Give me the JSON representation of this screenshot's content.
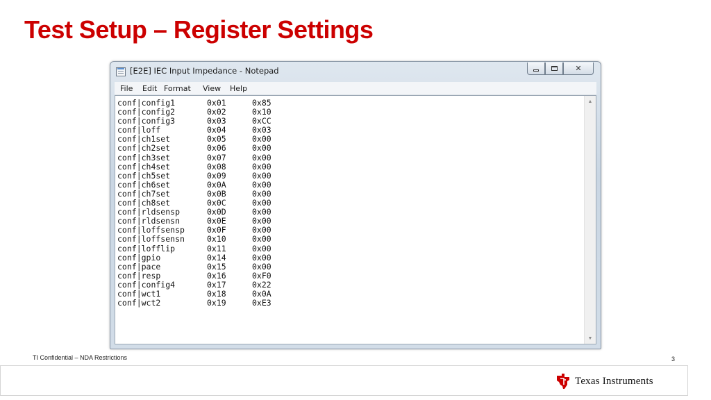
{
  "slide": {
    "title": "Test Setup – Register Settings",
    "footer": "TI Confidential – NDA Restrictions",
    "page_number": "3",
    "logo_text": "Texas Instruments"
  },
  "window": {
    "title": "[E2E] IEC Input Impedance - Notepad",
    "menu": [
      "File",
      "Edit",
      "Format",
      "View",
      "Help"
    ]
  },
  "registers": [
    {
      "name": "conf|config1",
      "addr": "0x01",
      "value": "0x85"
    },
    {
      "name": "conf|config2",
      "addr": "0x02",
      "value": "0x10"
    },
    {
      "name": "conf|config3",
      "addr": "0x03",
      "value": "0xCC"
    },
    {
      "name": "conf|loff",
      "addr": "0x04",
      "value": "0x03"
    },
    {
      "name": "conf|ch1set",
      "addr": "0x05",
      "value": "0x00"
    },
    {
      "name": "conf|ch2set",
      "addr": "0x06",
      "value": "0x00"
    },
    {
      "name": "conf|ch3set",
      "addr": "0x07",
      "value": "0x00"
    },
    {
      "name": "conf|ch4set",
      "addr": "0x08",
      "value": "0x00"
    },
    {
      "name": "conf|ch5set",
      "addr": "0x09",
      "value": "0x00"
    },
    {
      "name": "conf|ch6set",
      "addr": "0x0A",
      "value": "0x00"
    },
    {
      "name": "conf|ch7set",
      "addr": "0x0B",
      "value": "0x00"
    },
    {
      "name": "conf|ch8set",
      "addr": "0x0C",
      "value": "0x00"
    },
    {
      "name": "conf|rldsensp",
      "addr": "0x0D",
      "value": "0x00"
    },
    {
      "name": "conf|rldsensn",
      "addr": "0x0E",
      "value": "0x00"
    },
    {
      "name": "conf|loffsensp",
      "addr": "0x0F",
      "value": "0x00"
    },
    {
      "name": "conf|loffsensn",
      "addr": "0x10",
      "value": "0x00"
    },
    {
      "name": "conf|lofflip",
      "addr": "0x11",
      "value": "0x00"
    },
    {
      "name": "conf|gpio",
      "addr": "0x14",
      "value": "0x00"
    },
    {
      "name": "conf|pace",
      "addr": "0x15",
      "value": "0x00"
    },
    {
      "name": "conf|resp",
      "addr": "0x16",
      "value": "0xF0"
    },
    {
      "name": "conf|config4",
      "addr": "0x17",
      "value": "0x22"
    },
    {
      "name": "conf|wct1",
      "addr": "0x18",
      "value": "0x0A"
    },
    {
      "name": "conf|wct2",
      "addr": "0x19",
      "value": "0xE3"
    }
  ],
  "colors": {
    "title": "#cc0000",
    "logo_red": "#cc0000"
  },
  "icons": {
    "app": "notepad-icon",
    "minimize": "minimize-icon",
    "maximize": "maximize-icon",
    "close": "close-icon",
    "scroll_up": "scroll-up-icon",
    "scroll_down": "scroll-down-icon",
    "logo": "texas-instruments-logo-icon"
  }
}
